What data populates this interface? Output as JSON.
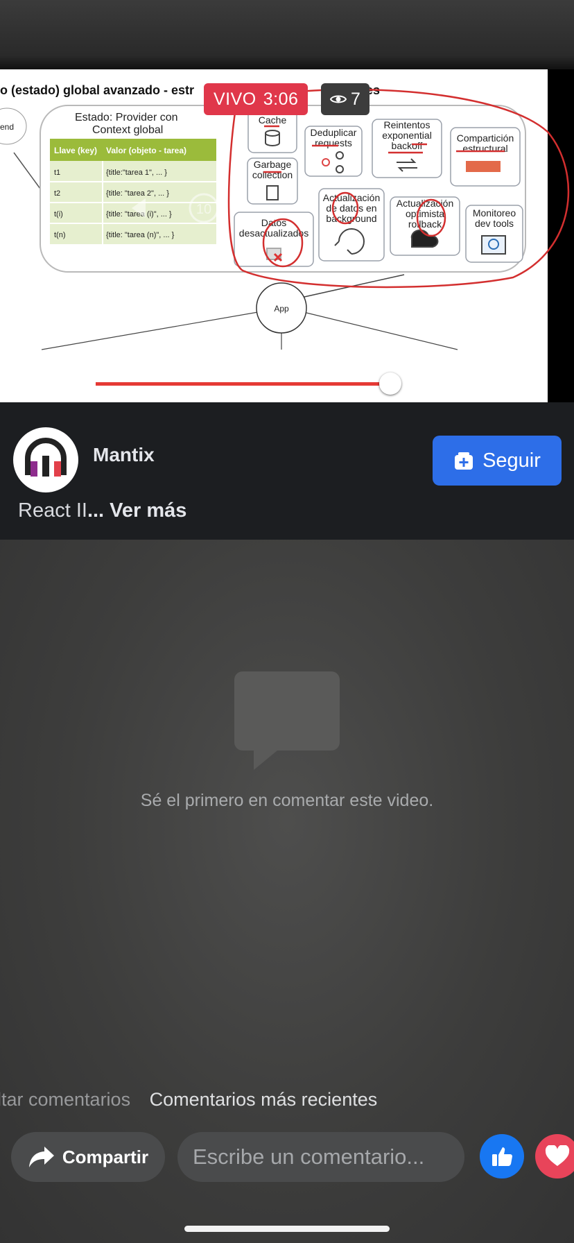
{
  "live": {
    "label": "VIVO",
    "elapsed": "3:06",
    "viewers": "7",
    "eye_icon": "eye-icon"
  },
  "slide": {
    "title": "o (estado) global avanzado - estr",
    "title_tail": "ores",
    "left_cut_label": "end",
    "provider_label_1": "Estado: Provider con",
    "provider_label_2": "Context global",
    "table_headers": [
      "Llave (key)",
      "Valor (objeto - tarea)"
    ],
    "table_rows": [
      [
        "t1",
        "{title:\"tarea 1\", ... }"
      ],
      [
        "t2",
        "{title: \"tarea 2\", ... }"
      ],
      [
        "t(i)",
        "{title: \"tarea (i)\", ... }"
      ],
      [
        "t(n)",
        "{title: \"tarea (n)\", ... }"
      ]
    ],
    "features": {
      "cache": "Cache",
      "dedup_1": "Deduplicar",
      "dedup_2": "requests",
      "retry_1": "Reintentos",
      "retry_2": "exponential",
      "retry_3": "backoff",
      "share_1": "Compartición",
      "share_2": "estructural",
      "gc_1": "Garbage",
      "gc_2": "collection",
      "stale_1": "Datos",
      "stale_2": "desactualizados",
      "bg_1": "Actualización",
      "bg_2": "de datos en",
      "bg_3": "background",
      "opt_1": "Actualización",
      "opt_2": "optimista",
      "opt_3": "rollback",
      "mon_1": "Monitoreo",
      "mon_2": "dev tools"
    },
    "app_node": "App",
    "rewind_label": "10"
  },
  "player": {
    "progress": 0.68
  },
  "channel": {
    "name": "Mantix",
    "follow_label": "Seguir"
  },
  "description": {
    "text": "React II",
    "more": "... Ver más"
  },
  "comments": {
    "empty_text": "Sé el primero en comentar este video.",
    "sort_inactive": "ltar comentarios",
    "sort_active": "Comentarios más recientes"
  },
  "actions": {
    "share_label": "Compartir",
    "comment_placeholder": "Escribe un comentario..."
  },
  "colors": {
    "live_red": "#e0374a",
    "follow_blue": "#2d6ee8",
    "like_blue": "#1877f2",
    "love_red": "#e8445a",
    "annotation_red": "#d32f2f"
  }
}
